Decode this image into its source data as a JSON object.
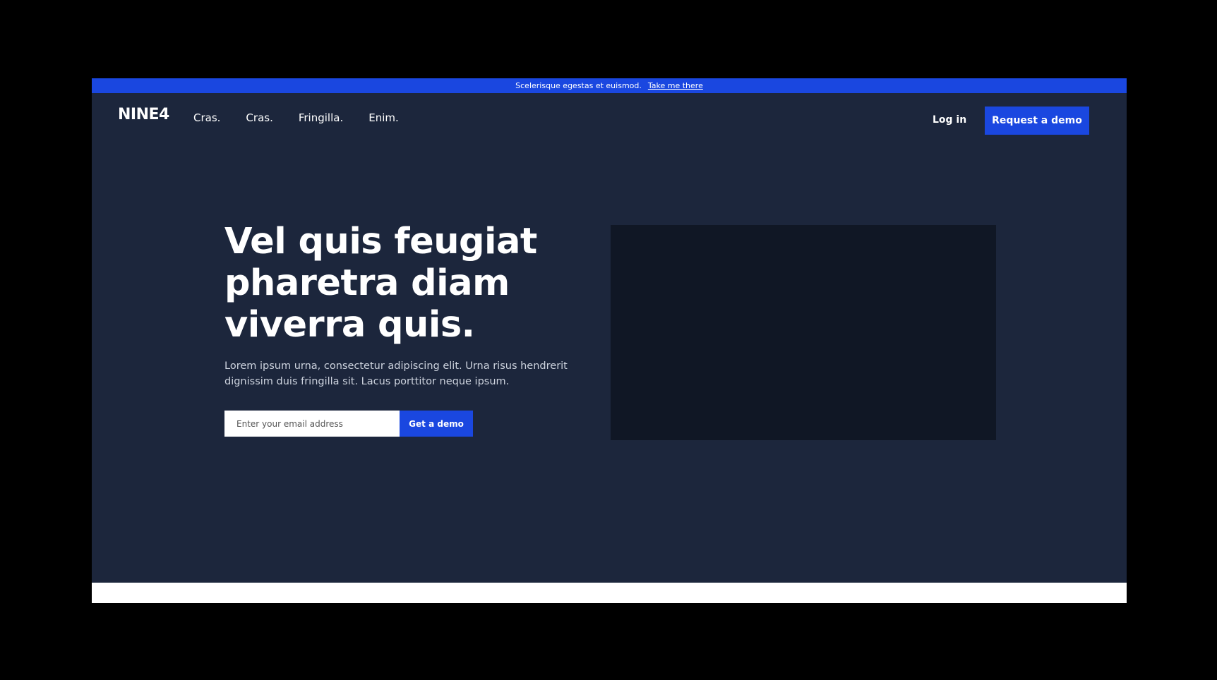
{
  "announcement": {
    "text": "Scelerisque egestas et euismod.",
    "link_label": "Take me there"
  },
  "header": {
    "logo": "NINE4",
    "nav_items": [
      "Cras.",
      "Cras.",
      "Fringilla.",
      "Enim."
    ],
    "login_label": "Log in",
    "cta_label": "Request a demo"
  },
  "hero": {
    "title": "Vel quis feugiat pharetra diam viverra quis.",
    "subtitle": "Lorem ipsum urna, consectetur adipiscing elit. Urna risus hendrerit dignissim duis fringilla sit. Lacus porttitor neque ipsum.",
    "email_placeholder": "Enter your email address",
    "submit_label": "Get a demo"
  },
  "colors": {
    "page_background": "#1c263c",
    "accent": "#1a47e0",
    "media_placeholder": "#101725",
    "outer_background": "#000000"
  }
}
